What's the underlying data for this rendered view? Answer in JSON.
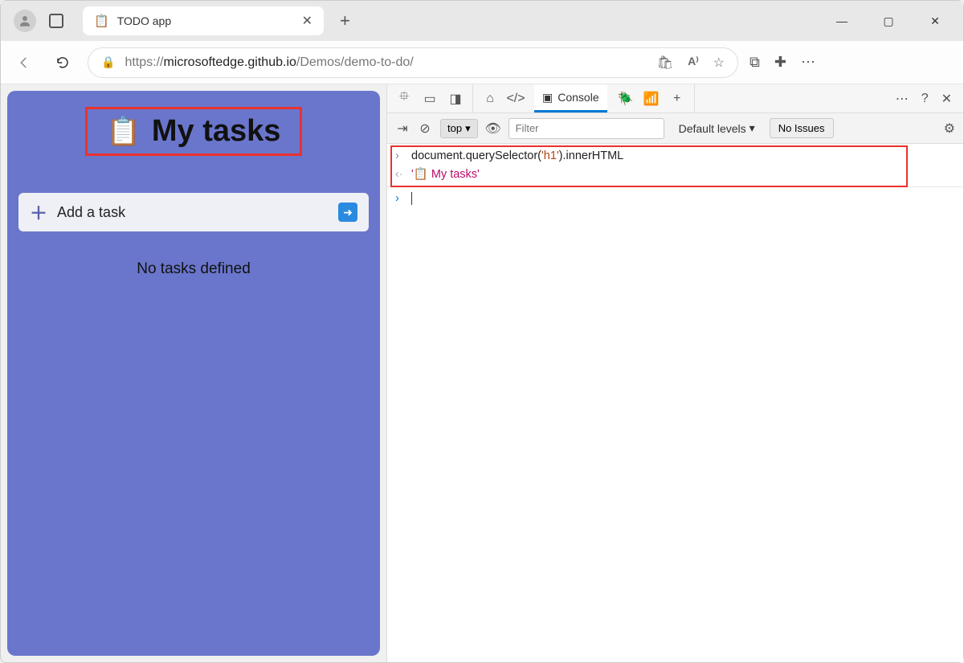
{
  "browser": {
    "tab_title": "TODO app",
    "tab_favicon": "📋",
    "url_prefix": "https://",
    "url_host": "microsoftedge.github.io",
    "url_path": "/Demos/demo-to-do/"
  },
  "page": {
    "title_emoji": "📋",
    "title_text": "My tasks",
    "add_task_label": "Add a task",
    "no_tasks_text": "No tasks defined"
  },
  "devtools": {
    "console_tab_label": "Console",
    "context_label": "top",
    "filter_placeholder": "Filter",
    "levels_label": "Default levels",
    "issues_label": "No Issues",
    "console_input_prefix": "document.querySelector(",
    "console_input_arg": "'h1'",
    "console_input_suffix": ").innerHTML",
    "console_output": "'📋 My tasks'"
  }
}
